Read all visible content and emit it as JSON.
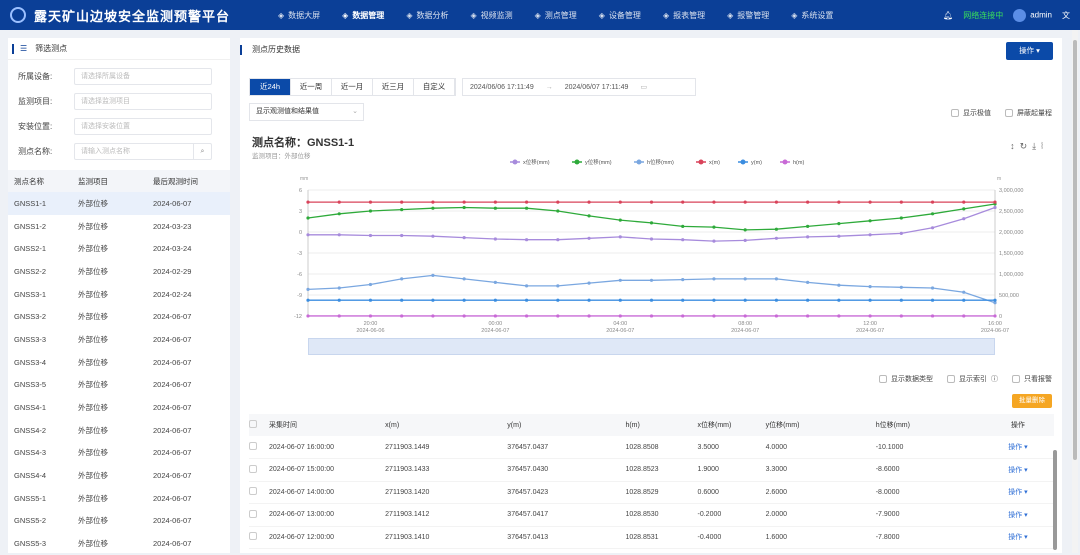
{
  "header": {
    "title": "露天矿山边坡安全监测预警平台",
    "nav": [
      {
        "label": "数据大屏",
        "icon": "monitor-icon"
      },
      {
        "label": "数据管理",
        "icon": "data-icon",
        "active": true
      },
      {
        "label": "数据分析",
        "icon": "analysis-icon"
      },
      {
        "label": "视频监测",
        "icon": "video-icon"
      },
      {
        "label": "测点管理",
        "icon": "point-icon"
      },
      {
        "label": "设备管理",
        "icon": "device-icon"
      },
      {
        "label": "报表管理",
        "icon": "report-icon"
      },
      {
        "label": "报警管理",
        "icon": "alarm-icon"
      },
      {
        "label": "系统设置",
        "icon": "gear-icon"
      }
    ],
    "status": "网络连接中",
    "user": "admin"
  },
  "sidebar": {
    "title": "筛选测点",
    "filters": [
      {
        "label": "所属设备:",
        "placeholder": "请选择所属设备"
      },
      {
        "label": "监测项目:",
        "placeholder": "请选择监测项目"
      },
      {
        "label": "安装位置:",
        "placeholder": "请选择安装位置"
      },
      {
        "label": "测点名称:",
        "placeholder": "请输入测点名称"
      }
    ],
    "columns": [
      "测点名称",
      "监测项目",
      "最后观测时间"
    ],
    "rows": [
      [
        "GNSS1-1",
        "外部位移",
        "2024-06-07"
      ],
      [
        "GNSS1-2",
        "外部位移",
        "2024-03-23"
      ],
      [
        "GNSS2-1",
        "外部位移",
        "2024-03-24"
      ],
      [
        "GNSS2-2",
        "外部位移",
        "2024-02-29"
      ],
      [
        "GNSS3-1",
        "外部位移",
        "2024-02-24"
      ],
      [
        "GNSS3-2",
        "外部位移",
        "2024-06-07"
      ],
      [
        "GNSS3-3",
        "外部位移",
        "2024-06-07"
      ],
      [
        "GNSS3-4",
        "外部位移",
        "2024-06-07"
      ],
      [
        "GNSS3-5",
        "外部位移",
        "2024-06-07"
      ],
      [
        "GNSS4-1",
        "外部位移",
        "2024-06-07"
      ],
      [
        "GNSS4-2",
        "外部位移",
        "2024-06-07"
      ],
      [
        "GNSS4-3",
        "外部位移",
        "2024-06-07"
      ],
      [
        "GNSS4-4",
        "外部位移",
        "2024-06-07"
      ],
      [
        "GNSS5-1",
        "外部位移",
        "2024-06-07"
      ],
      [
        "GNSS5-2",
        "外部位移",
        "2024-06-07"
      ],
      [
        "GNSS5-3",
        "外部位移",
        "2024-06-07"
      ]
    ]
  },
  "main": {
    "title": "测点历史数据",
    "op_button": "操作",
    "tabs": [
      "近24h",
      "近一周",
      "近一月",
      "近三月",
      "自定义"
    ],
    "date_start": "2024/06/06 17:11:49",
    "date_sep": "→",
    "date_end": "2024/06/07 17:11:49",
    "display_select": "显示观测值和结果值",
    "show_extreme": "显示极值",
    "hide_range": "屏蔽起量程",
    "point_name": "测点名称：GNSS1-1",
    "point_sub": "监测项目：外部位移",
    "opt_type": "显示数据类型",
    "opt_index": "显示索引",
    "opt_alarm": "只看报警",
    "export": "批量删除"
  },
  "chart_data": {
    "type": "line",
    "xlabels": [
      [
        "20:00",
        "2024-06-06"
      ],
      [
        "00:00",
        "2024-06-07"
      ],
      [
        "04:00",
        "2024-06-07"
      ],
      [
        "08:00",
        "2024-06-07"
      ],
      [
        "12:00",
        "2024-06-07"
      ],
      [
        "16:00",
        "2024-06-07"
      ]
    ],
    "x_hours": "hourly 18:00 (06-06) to 16:00 (06-07)",
    "left_axis": {
      "unit": "mm",
      "range": [
        -12,
        6
      ],
      "ticks": [
        "6",
        "3",
        "0",
        "-3",
        "-6",
        "-9",
        "-12"
      ]
    },
    "right_axis": {
      "unit": "m",
      "range": [
        0,
        3000000
      ],
      "ticks": [
        "3,000,000",
        "2,500,000",
        "2,000,000",
        "1,500,000",
        "1,000,000",
        "500,000",
        "0"
      ]
    },
    "series": [
      {
        "name": "x位移(mm)",
        "color": "#a78bdc",
        "axis": "left",
        "values": [
          -0.4,
          -0.4,
          -0.5,
          -0.5,
          -0.6,
          -0.8,
          -1.0,
          -1.1,
          -1.1,
          -0.9,
          -0.7,
          -1.0,
          -1.1,
          -1.3,
          -1.2,
          -0.9,
          -0.7,
          -0.6,
          -0.4,
          -0.2,
          0.6,
          1.9,
          3.5
        ]
      },
      {
        "name": "y位移(mm)",
        "color": "#2eaa3a",
        "axis": "left",
        "values": [
          2.0,
          2.6,
          3.0,
          3.2,
          3.4,
          3.5,
          3.4,
          3.4,
          3.0,
          2.3,
          1.7,
          1.3,
          0.8,
          0.7,
          0.3,
          0.4,
          0.8,
          1.2,
          1.6,
          2.0,
          2.6,
          3.3,
          4.0
        ]
      },
      {
        "name": "h位移(mm)",
        "color": "#7aa7e0",
        "axis": "left",
        "values": [
          -8.2,
          -8.0,
          -7.5,
          -6.7,
          -6.2,
          -6.7,
          -7.2,
          -7.7,
          -7.7,
          -7.3,
          -6.9,
          -6.9,
          -6.8,
          -6.7,
          -6.7,
          -6.7,
          -7.2,
          -7.6,
          -7.8,
          -7.9,
          -8.0,
          -8.6,
          -10.1
        ]
      },
      {
        "name": "x(m)",
        "color": "#d9435a",
        "axis": "right",
        "values": [
          2711903.14,
          2711903.14,
          2711903.14,
          2711903.14,
          2711903.14,
          2711903.14,
          2711903.14,
          2711903.14,
          2711903.14,
          2711903.14,
          2711903.14,
          2711903.14,
          2711903.14,
          2711903.14,
          2711903.14,
          2711903.14,
          2711903.14,
          2711903.14,
          2711903.141,
          2711903.1412,
          2711903.142,
          2711903.1433,
          2711903.1449
        ]
      },
      {
        "name": "y(m)",
        "color": "#3b8de0",
        "axis": "right",
        "values": [
          376457.04,
          376457.04,
          376457.04,
          376457.04,
          376457.04,
          376457.04,
          376457.04,
          376457.04,
          376457.04,
          376457.04,
          376457.04,
          376457.04,
          376457.04,
          376457.04,
          376457.04,
          376457.04,
          376457.04,
          376457.04,
          376457.0413,
          376457.0417,
          376457.0423,
          376457.043,
          376457.0437
        ]
      },
      {
        "name": "h(m)",
        "color": "#c86ad6",
        "axis": "right",
        "values": [
          1028.85,
          1028.85,
          1028.85,
          1028.85,
          1028.85,
          1028.85,
          1028.85,
          1028.85,
          1028.85,
          1028.85,
          1028.85,
          1028.85,
          1028.85,
          1028.85,
          1028.85,
          1028.85,
          1028.85,
          1028.85,
          1028.8531,
          1028.853,
          1028.8529,
          1028.8523,
          1028.8508
        ]
      }
    ]
  },
  "table": {
    "columns": [
      "采集时间",
      "x(m)",
      "y(m)",
      "h(m)",
      "x位移(mm)",
      "y位移(mm)",
      "h位移(mm)",
      "操作"
    ],
    "action": "操作",
    "rows": [
      [
        "2024-06-07 16:00:00",
        "2711903.1449",
        "376457.0437",
        "1028.8508",
        "3.5000",
        "4.0000",
        "-10.1000"
      ],
      [
        "2024-06-07 15:00:00",
        "2711903.1433",
        "376457.0430",
        "1028.8523",
        "1.9000",
        "3.3000",
        "-8.6000"
      ],
      [
        "2024-06-07 14:00:00",
        "2711903.1420",
        "376457.0423",
        "1028.8529",
        "0.6000",
        "2.6000",
        "-8.0000"
      ],
      [
        "2024-06-07 13:00:00",
        "2711903.1412",
        "376457.0417",
        "1028.8530",
        "-0.2000",
        "2.0000",
        "-7.9000"
      ],
      [
        "2024-06-07 12:00:00",
        "2711903.1410",
        "376457.0413",
        "1028.8531",
        "-0.4000",
        "1.6000",
        "-7.8000"
      ]
    ]
  }
}
